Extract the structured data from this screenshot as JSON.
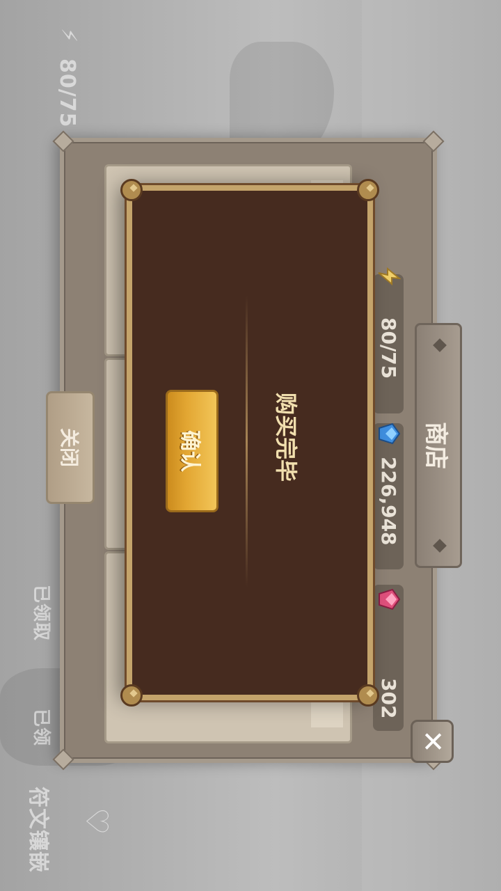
{
  "hud": {
    "energy_top": "80/75",
    "rune_inlay_label": "符文镶嵌",
    "faded_left": "已领",
    "faded_mid": "已领取"
  },
  "shop": {
    "title": "商店",
    "close_icon": "✕",
    "energy": "80/75",
    "coins": "226,948",
    "gems": "302",
    "bottom_close_label": "关闭"
  },
  "modal": {
    "message": "购买完毕",
    "confirm_label": "确认"
  },
  "colors": {
    "modal_bg": "#462b1f",
    "modal_border": "#c4a46b",
    "confirm_gold": "#e3a733",
    "panel_bg": "#8d8174"
  },
  "icons": [
    "lightning-icon",
    "blue-crystal-icon",
    "pink-gem-icon",
    "close-icon"
  ]
}
